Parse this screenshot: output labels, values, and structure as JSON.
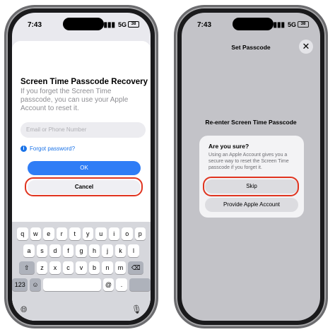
{
  "left": {
    "status": {
      "time": "7:43",
      "network": "5G",
      "battery": "38"
    },
    "title": "Screen Time Passcode Recovery",
    "description": "If you forget the Screen Time passcode, you can use your Apple Account to reset it.",
    "input_placeholder": "Email or Phone Number",
    "forgot_label": "Forgot password?",
    "ok_label": "OK",
    "cancel_label": "Cancel",
    "keyboard": {
      "row1": [
        "q",
        "w",
        "e",
        "r",
        "t",
        "y",
        "u",
        "i",
        "o",
        "p"
      ],
      "row2": [
        "a",
        "s",
        "d",
        "f",
        "g",
        "h",
        "j",
        "k",
        "l"
      ],
      "row3": [
        "z",
        "x",
        "c",
        "v",
        "b",
        "n",
        "m"
      ],
      "numbers_label": "123",
      "at_label": "@",
      "dot_label": "."
    }
  },
  "right": {
    "status": {
      "time": "7:43",
      "network": "5G",
      "battery": "38"
    },
    "header_title": "Set Passcode",
    "reenter_label": "Re-enter Screen Time Passcode",
    "alert": {
      "title": "Are you sure?",
      "message": "Using an Apple Account gives you a secure way to reset the Screen Time passcode if you forget it.",
      "skip_label": "Skip",
      "provide_label": "Provide Apple Account"
    }
  },
  "colors": {
    "accent": "#2f7df6",
    "highlight": "#e0341f"
  }
}
